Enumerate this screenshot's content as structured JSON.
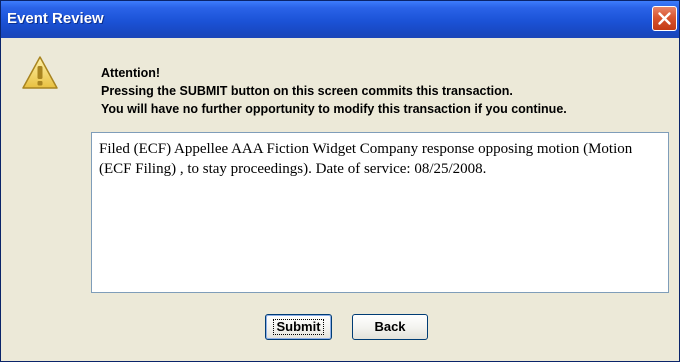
{
  "window": {
    "title": "Event Review",
    "close_icon": "close-icon",
    "accent_color": "#1b52d6",
    "close_color": "#d9552f"
  },
  "dialog": {
    "icon": "warning-icon",
    "message_lines": [
      "Attention!",
      "Pressing the SUBMIT button on this screen commits this transaction.",
      "You will have no further opportunity to modify this transaction if you continue."
    ],
    "details_text": "Filed (ECF) Appellee AAA Fiction Widget Company response opposing motion (Motion (ECF Filing) , to stay proceedings). Date of service: 08/25/2008."
  },
  "buttons": {
    "submit_label": "Submit",
    "back_label": "Back"
  }
}
